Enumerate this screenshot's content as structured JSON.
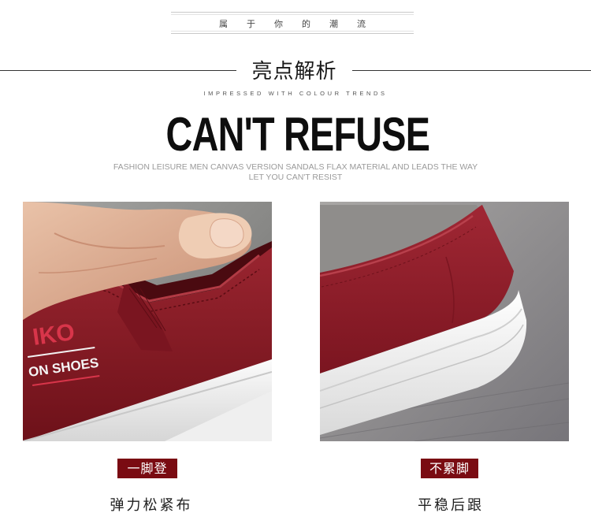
{
  "header": {
    "slogan": "属于你的潮流",
    "section_title": "亮点解析",
    "tagline_en": "IMPRESSED WITH COLOUR TRENDS",
    "headline": "CAN'T REFUSE",
    "description_line1": "FASHION LEISURE MEN CANVAS VERSION SANDALS FLAX MATERIAL AND LEADS THE WAY",
    "description_line2": "LET YOU CAN'T RESIST"
  },
  "features": [
    {
      "tag": "一脚登",
      "caption": "弹力松紧布",
      "photo_label_top": "IKO",
      "photo_label_bottom": "ON SHOES"
    },
    {
      "tag": "不累脚",
      "caption": "平稳后跟"
    }
  ],
  "colors": {
    "tag_bg": "#7a0b12",
    "shoe_red": "#8e1c26",
    "text_dark": "#1a1a1a",
    "desc_gray": "#9a9a9a"
  }
}
